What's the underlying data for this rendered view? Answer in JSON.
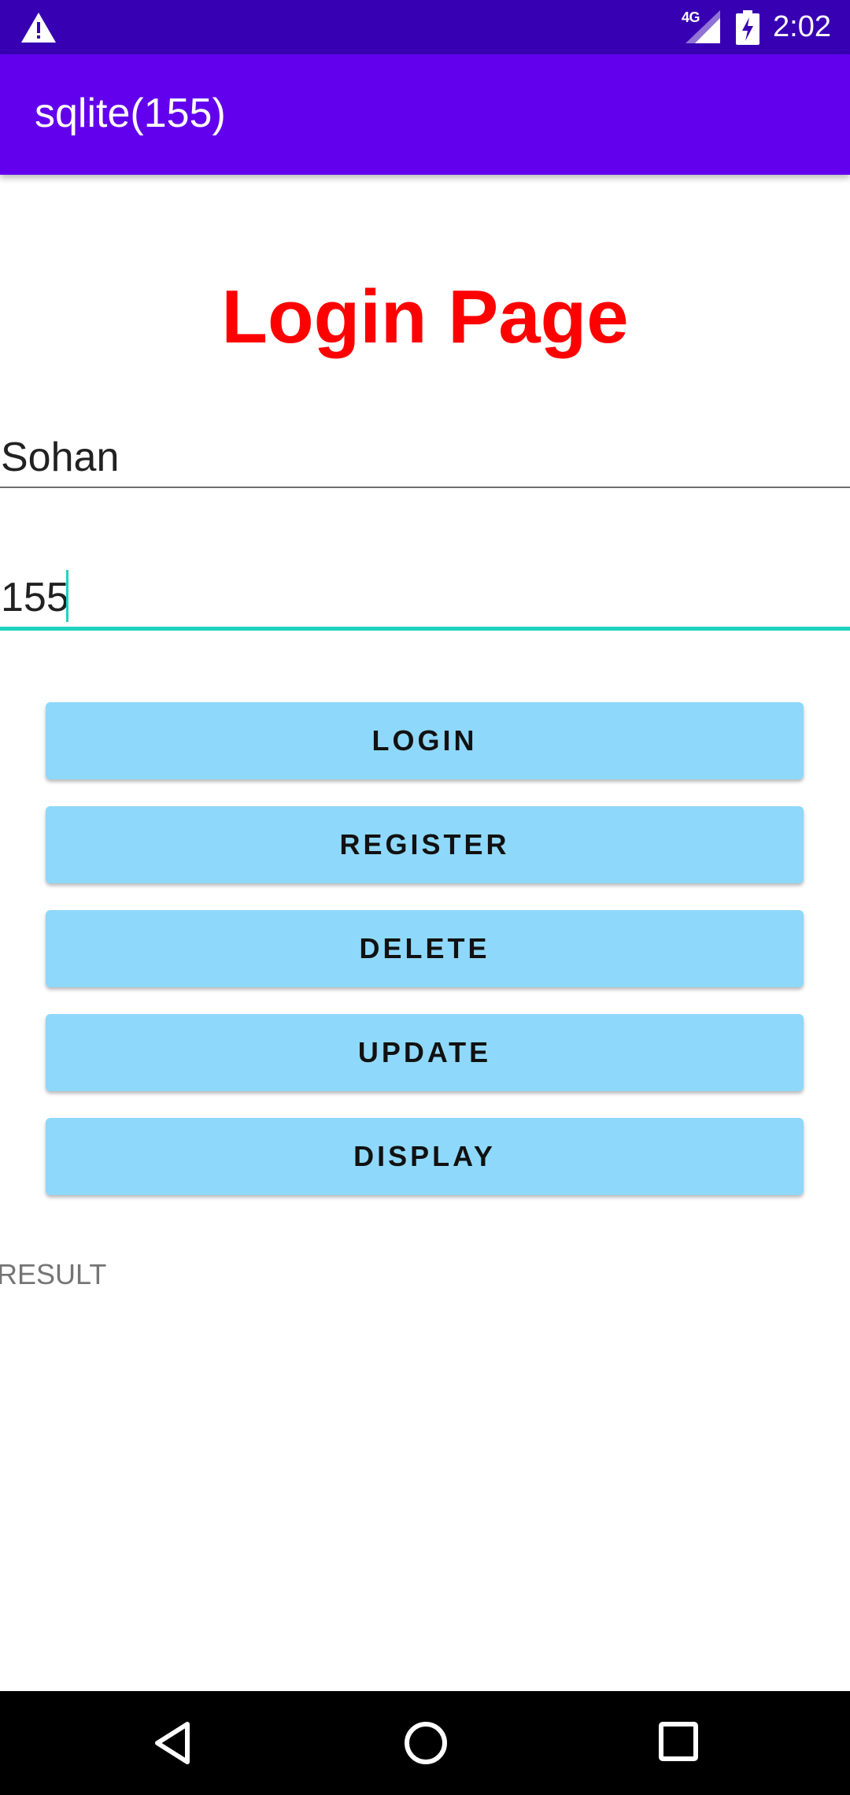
{
  "status_bar": {
    "network": "4G",
    "time": "2:02",
    "icons": [
      "warning-icon",
      "signal-icon",
      "battery-charging-icon"
    ]
  },
  "app_bar": {
    "title": "sqlite(155)",
    "color": "#6200ee"
  },
  "page": {
    "heading": "Login Page",
    "heading_color": "#ff0000"
  },
  "form": {
    "username_value": "Sohan",
    "password_value": "155",
    "accent_color": "#1ed3c0"
  },
  "buttons": {
    "login": "LOGIN",
    "register": "REGISTER",
    "delete": "DELETE",
    "update": "UPDATE",
    "display": "DISPLAY",
    "color": "#8ed8fb"
  },
  "result": {
    "label": "RESULT"
  },
  "nav_bar": {
    "icons": [
      "back-icon",
      "home-icon",
      "recents-icon"
    ]
  }
}
